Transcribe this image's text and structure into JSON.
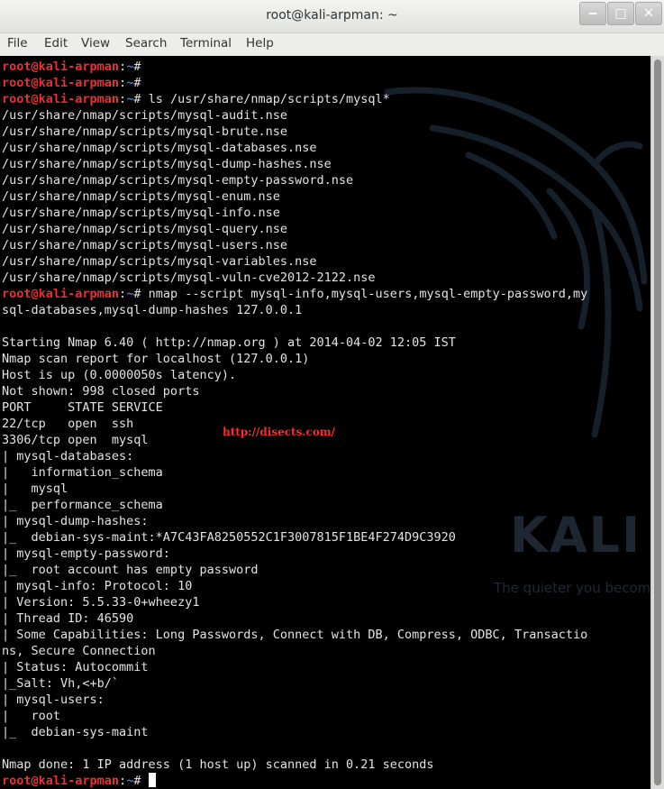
{
  "window": {
    "title": "root@kali-arpman: ~",
    "controls": {
      "minimize": "‒",
      "maximize": "□",
      "close": "✕"
    }
  },
  "menu": [
    "File",
    "Edit",
    "View",
    "Search",
    "Terminal",
    "Help"
  ],
  "watermark": {
    "url": "http://disects.com/",
    "brand": "KALI",
    "tagline": "The quieter you becom"
  },
  "prompt": {
    "user_host": "root@kali-arpman",
    "sep": ":",
    "path": "~",
    "symbol": "#"
  },
  "terminal": {
    "cmd1": "",
    "cmd2": "",
    "cmd3": " ls /usr/share/nmap/scripts/mysql*",
    "files": [
      "/usr/share/nmap/scripts/mysql-audit.nse",
      "/usr/share/nmap/scripts/mysql-brute.nse",
      "/usr/share/nmap/scripts/mysql-databases.nse",
      "/usr/share/nmap/scripts/mysql-dump-hashes.nse",
      "/usr/share/nmap/scripts/mysql-empty-password.nse",
      "/usr/share/nmap/scripts/mysql-enum.nse",
      "/usr/share/nmap/scripts/mysql-info.nse",
      "/usr/share/nmap/scripts/mysql-query.nse",
      "/usr/share/nmap/scripts/mysql-users.nse",
      "/usr/share/nmap/scripts/mysql-variables.nse",
      "/usr/share/nmap/scripts/mysql-vuln-cve2012-2122.nse"
    ],
    "cmd4": " nmap --script mysql-info,mysql-users,mysql-empty-password,my",
    "cmd4_wrap": "sql-databases,mysql-dump-hashes 127.0.0.1",
    "output": [
      "",
      "Starting Nmap 6.40 ( http://nmap.org ) at 2014-04-02 12:05 IST",
      "Nmap scan report for localhost (127.0.0.1)",
      "Host is up (0.0000050s latency).",
      "Not shown: 998 closed ports",
      "PORT     STATE SERVICE",
      "22/tcp   open  ssh",
      "3306/tcp open  mysql",
      "| mysql-databases:",
      "|   information_schema",
      "|   mysql",
      "|_  performance_schema",
      "| mysql-dump-hashes:",
      "|_  debian-sys-maint:*A7C43FA8250552C1F3007815F1BE4F274D9C3920",
      "| mysql-empty-password:",
      "|_  root account has empty password",
      "| mysql-info: Protocol: 10",
      "| Version: 5.5.33-0+wheezy1",
      "| Thread ID: 46590",
      "| Some Capabilities: Long Passwords, Connect with DB, Compress, ODBC, Transactio",
      "ns, Secure Connection",
      "| Status: Autocommit",
      "|_Salt: Vh,<+b/`",
      "| mysql-users:",
      "|   root",
      "|_  debian-sys-maint",
      "",
      "Nmap done: 1 IP address (1 host up) scanned in 0.21 seconds"
    ],
    "cmd_last": " "
  },
  "colors": {
    "prompt_user": "#e8312f",
    "prompt_path": "#3a7de0",
    "text": "#e3e3e3",
    "background": "#000000",
    "url": "#ff2a2a"
  }
}
